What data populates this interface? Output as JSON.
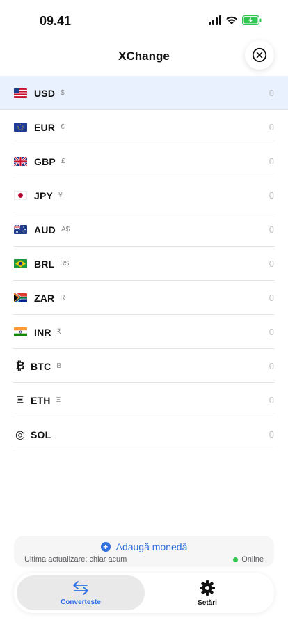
{
  "status_bar": {
    "time": "09.41",
    "icons": [
      "cellular-signal-icon",
      "wifi-icon",
      "battery-charging-icon"
    ],
    "battery_color": "#33c653"
  },
  "header": {
    "title": "XChange",
    "close_icon": "close-circle-icon"
  },
  "currencies": [
    {
      "code": "USD",
      "symbol": "$",
      "value": "0",
      "icon": "us-flag-icon",
      "selected": true
    },
    {
      "code": "EUR",
      "symbol": "€",
      "value": "0",
      "icon": "eu-flag-icon"
    },
    {
      "code": "GBP",
      "symbol": "£",
      "value": "0",
      "icon": "uk-flag-icon"
    },
    {
      "code": "JPY",
      "symbol": "¥",
      "value": "0",
      "icon": "japan-flag-icon"
    },
    {
      "code": "AUD",
      "symbol": "A$",
      "value": "0",
      "icon": "australia-flag-icon"
    },
    {
      "code": "BRL",
      "symbol": "R$",
      "value": "0",
      "icon": "brazil-flag-icon"
    },
    {
      "code": "ZAR",
      "symbol": "R",
      "value": "0",
      "icon": "south-africa-flag-icon"
    },
    {
      "code": "INR",
      "symbol": "₹",
      "value": "0",
      "icon": "india-flag-icon"
    },
    {
      "code": "BTC",
      "symbol": "B",
      "value": "0",
      "icon": "bitcoin-icon",
      "glyph": "₿"
    },
    {
      "code": "ETH",
      "symbol": "Ξ",
      "value": "0",
      "icon": "ethereum-icon",
      "glyph": "Ξ"
    },
    {
      "code": "SOL",
      "symbol": "",
      "value": "0",
      "icon": "solana-icon",
      "glyph": "◎"
    }
  ],
  "footer": {
    "add_currency_label": "Adaugă monedă",
    "last_update": "Ultima actualizare: chiar acum",
    "status": "Online",
    "status_color": "#33c653"
  },
  "tabs": {
    "convert_label": "Convertește",
    "convert_icon": "swap-arrows-icon",
    "settings_label": "Setări",
    "settings_icon": "gear-icon",
    "active": "convert",
    "accent": "#2f6fdf"
  }
}
